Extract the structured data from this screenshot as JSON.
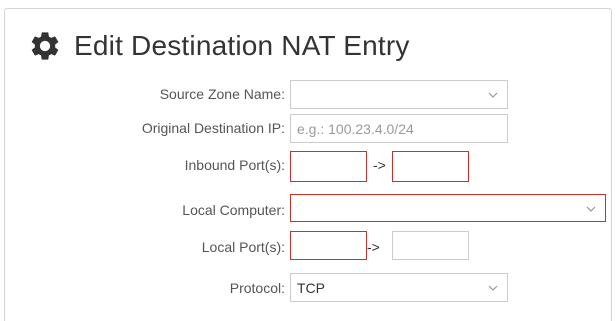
{
  "header": {
    "title": "Edit Destination NAT Entry",
    "icon": "gear-icon"
  },
  "form": {
    "source_zone": {
      "label": "Source Zone Name:",
      "value": ""
    },
    "original_destination_ip": {
      "label": "Original Destination IP:",
      "placeholder": "e.g.: 100.23.4.0/24",
      "value": ""
    },
    "inbound_ports": {
      "label": "Inbound Port(s):",
      "from": "",
      "separator": "->",
      "to": ""
    },
    "local_computer": {
      "label": "Local Computer:",
      "value": ""
    },
    "local_ports": {
      "label": "Local Port(s):",
      "from": "",
      "separator": "->",
      "to": ""
    },
    "protocol": {
      "label": "Protocol:",
      "value": "TCP"
    }
  },
  "colors": {
    "error_border": "#c9302c",
    "input_border": "#cccccc",
    "placeholder": "#9a9a9a"
  }
}
